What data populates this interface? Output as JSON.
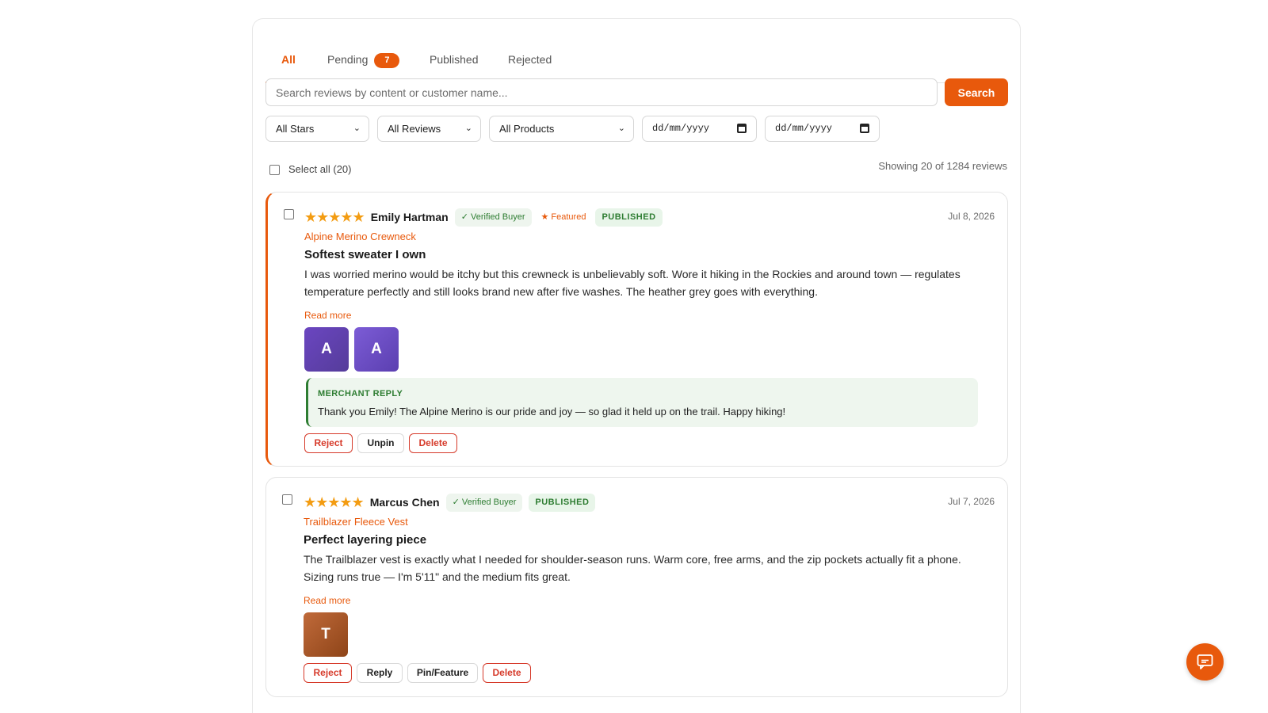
{
  "tabs": [
    {
      "label": "All",
      "active": true
    },
    {
      "label": "Pending",
      "count": "7"
    },
    {
      "label": "Published"
    },
    {
      "label": "Rejected"
    }
  ],
  "search": {
    "placeholder": "Search reviews by content or customer name...",
    "button_label": "Search"
  },
  "filters": {
    "stars": "All Stars",
    "reviews": "All Reviews",
    "products": "All Products",
    "date_from": "dd/mm/yyyy",
    "date_to": "dd/mm/yyyy"
  },
  "list_header": {
    "select_all": "Select all (20)",
    "showing": "Showing 20 of 1284 reviews"
  },
  "reviews": [
    {
      "stars": "★★★★★",
      "rating": 5,
      "author": "Emily Hartman",
      "verified": "✓ Verified Buyer",
      "featured": "★ Featured",
      "status": "PUBLISHED",
      "date": "Jul 8, 2026",
      "product": "Alpine Merino Crewneck",
      "title": "Softest sweater I own",
      "body": "I was worried merino would be itchy but this crewneck is unbelievably soft. Wore it hiking in the Rockies and around town — regulates temperature perfectly and still looks brand new after five washes. The heather grey goes with everything.",
      "read_more": "Read more",
      "photos": [
        "A",
        "A"
      ],
      "merchant_reply": {
        "label": "MERCHANT REPLY",
        "text": "Thank you Emily! The Alpine Merino is our pride and joy — so glad it held up on the trail. Happy hiking!"
      },
      "actions": {
        "reject": "Reject",
        "unpin": "Unpin",
        "delete": "Delete"
      }
    },
    {
      "stars": "★★★★★",
      "rating": 5,
      "author": "Marcus Chen",
      "verified": "✓ Verified Buyer",
      "status": "PUBLISHED",
      "date": "Jul 7, 2026",
      "product": "Trailblazer Fleece Vest",
      "title": "Perfect layering piece",
      "body": "The Trailblazer vest is exactly what I needed for shoulder-season runs. Warm core, free arms, and the zip pockets actually fit a phone. Sizing runs true — I'm 5'11\" and the medium fits great.",
      "read_more": "Read more",
      "photos": [
        "T"
      ],
      "actions": {
        "reject": "Reject",
        "reply": "Reply",
        "pin": "Pin/Feature",
        "delete": "Delete"
      }
    }
  ],
  "colors": {
    "accent": "#e8590c",
    "success": "#2e7d32",
    "danger": "#d63a2a",
    "star": "#f39c12"
  }
}
